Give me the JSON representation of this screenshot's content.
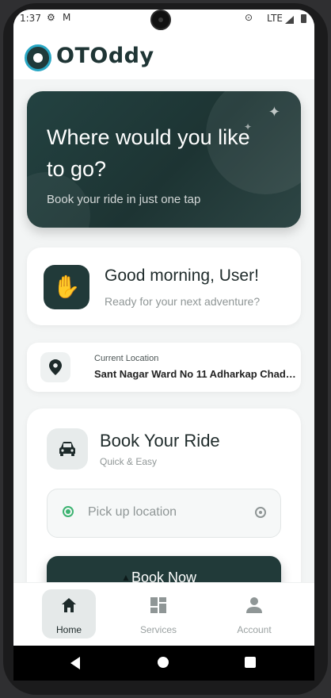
{
  "status_bar": {
    "time": "1:37",
    "network": "LTE",
    "icons": [
      "gear-icon",
      "gmail-icon",
      "location-icon",
      "signal-icon",
      "battery-icon"
    ]
  },
  "app": {
    "name": "OTOddy"
  },
  "hero": {
    "headline": "Where would you like to go?",
    "subtitle": "Book your ride in just one tap"
  },
  "greeting": {
    "title": "Good morning, User!",
    "subtitle": "Ready for your next adventure?"
  },
  "location": {
    "label": "Current Location",
    "value": "Sant Nagar Ward No 11 Adharkap Chadd..."
  },
  "booking": {
    "title": "Book Your Ride",
    "subtitle": "Quick & Easy",
    "pickup_placeholder": "Pick up location",
    "button_label": "Book Now"
  },
  "bottom_nav": {
    "items": [
      {
        "label": "Home",
        "icon": "home-icon",
        "active": true
      },
      {
        "label": "Services",
        "icon": "grid-icon",
        "active": false
      },
      {
        "label": "Account",
        "icon": "person-icon",
        "active": false
      }
    ]
  },
  "colors": {
    "primary": "#213a39",
    "accent_green": "#3cb371",
    "logo_ring": "#29a7c4",
    "background": "#f3f5f5"
  }
}
